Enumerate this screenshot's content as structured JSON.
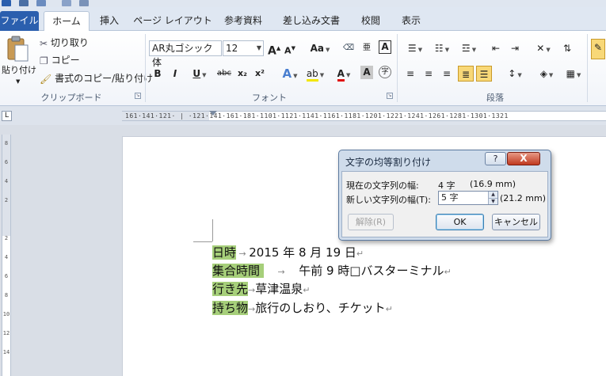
{
  "tabs": {
    "file": "ファイル",
    "home": "ホーム",
    "insert": "挿入",
    "page_layout": "ページ レイアウト",
    "references": "参考資料",
    "mailings": "差し込み文書",
    "review": "校閲",
    "view": "表示"
  },
  "clipboard": {
    "paste": "貼り付け",
    "cut": "切り取り",
    "copy": "コピー",
    "format_painter": "書式のコピー/貼り付け",
    "group_label": "クリップボード"
  },
  "font": {
    "name": "AR丸ゴシック体",
    "size": "12",
    "grow": "A",
    "shrink": "A",
    "case": "Aa",
    "bold": "B",
    "italic": "I",
    "underline": "U",
    "strike": "abc",
    "subscript": "x₂",
    "superscript": "x²",
    "group_label": "フォント"
  },
  "paragraph": {
    "group_label": "段落"
  },
  "ruler": {
    "corner": "L",
    "ticks": "161·141·121· | ·121·141·161·181·1101·1121·1141·1161·1181·1201·1221·1241·1261·1281·1301·1321",
    "vticks": [
      "8",
      "6",
      "4",
      "2",
      "",
      "2",
      "4",
      "6",
      "8",
      "10",
      "12",
      "14"
    ]
  },
  "document": {
    "lines": [
      {
        "label": "日時",
        "rest": "2015 年 8 月 19 日"
      },
      {
        "label": "集合時間",
        "rest": "午前 9 時□バスターミナル"
      },
      {
        "label": "行き先",
        "rest": "草津温泉"
      },
      {
        "label": "持ち物",
        "rest": "旅行のしおり、チケット"
      }
    ]
  },
  "dialog": {
    "title": "文字の均等割り付け",
    "help": "?",
    "close": "X",
    "current_label": "現在の文字列の幅:",
    "current_value": "4 字",
    "current_mm": "(16.9 mm)",
    "new_label": "新しい文字列の幅(T):",
    "new_value": "5 字",
    "new_mm": "(21.2 mm)",
    "release": "解除(R)",
    "ok": "OK",
    "cancel": "キャンセル"
  }
}
